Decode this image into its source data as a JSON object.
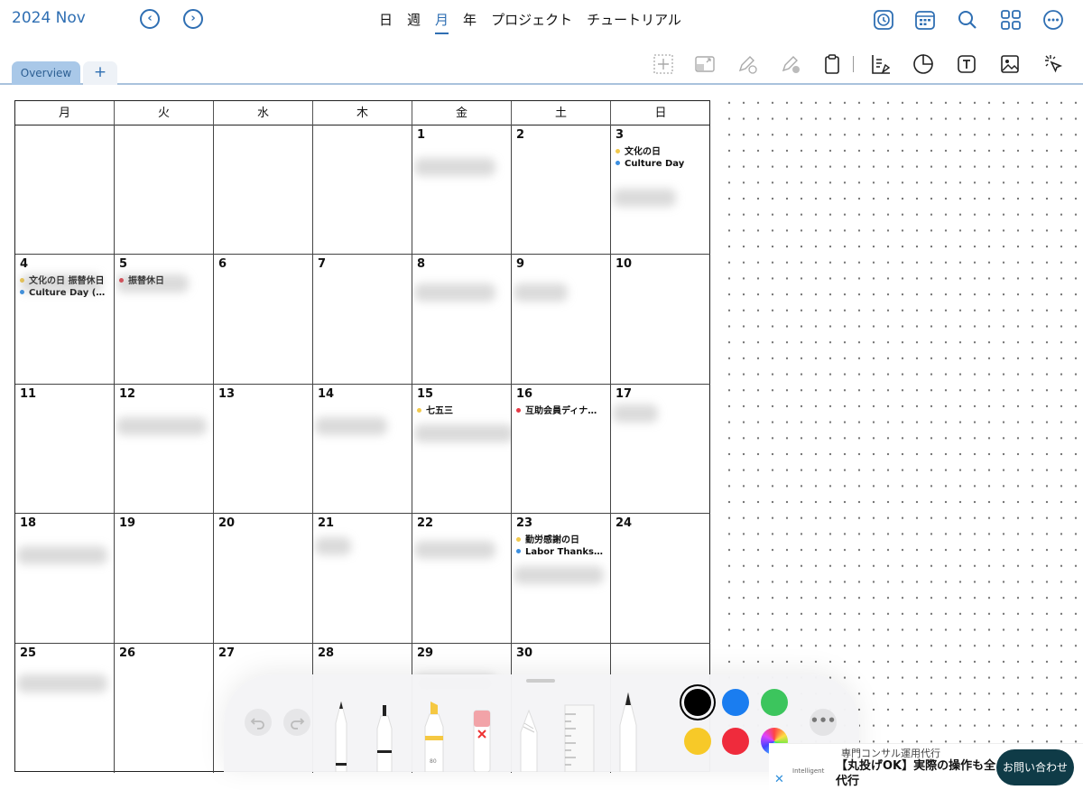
{
  "header": {
    "month_title": "2024 Nov",
    "prev_glyph": "‹",
    "next_glyph": "›",
    "views": [
      "日",
      "週",
      "月",
      "年",
      "プロジェクト",
      "チュートリアル"
    ],
    "active_view": "月",
    "icons": [
      "clock-icon",
      "calendar-icon",
      "search-icon",
      "grid-icon",
      "more-icon"
    ]
  },
  "tabs": {
    "overview": "Overview",
    "add": "+"
  },
  "tools": [
    "lasso-select-icon",
    "resize-icon",
    "pencil-circle-icon",
    "pencil-circle-alt-icon",
    "clipboard-icon",
    "shapes-icon",
    "sticker-icon",
    "text-box-icon",
    "image-icon",
    "pointer-icon"
  ],
  "calendar": {
    "weekdays": [
      "月",
      "火",
      "水",
      "木",
      "金",
      "土",
      "日"
    ],
    "weeks": [
      [
        {
          "day": "",
          "events": []
        },
        {
          "day": "",
          "events": []
        },
        {
          "day": "",
          "events": []
        },
        {
          "day": "",
          "events": []
        },
        {
          "day": "1",
          "events": []
        },
        {
          "day": "2",
          "events": []
        },
        {
          "day": "3",
          "events": [
            {
              "text": "文化の日",
              "color": "#f2c94c"
            },
            {
              "text": "Culture Day",
              "color": "#3b8fe0"
            }
          ]
        }
      ],
      [
        {
          "day": "4",
          "events": [
            {
              "text": "文化の日 振替休日",
              "color": "#f2c94c"
            },
            {
              "text": "Culture Day (o…",
              "color": "#3b8fe0"
            }
          ]
        },
        {
          "day": "5",
          "events": [
            {
              "text": "振替休日",
              "color": "#e53945"
            }
          ]
        },
        {
          "day": "6",
          "events": []
        },
        {
          "day": "7",
          "events": []
        },
        {
          "day": "8",
          "events": []
        },
        {
          "day": "9",
          "events": []
        },
        {
          "day": "10",
          "events": []
        }
      ],
      [
        {
          "day": "11",
          "events": []
        },
        {
          "day": "12",
          "events": []
        },
        {
          "day": "13",
          "events": []
        },
        {
          "day": "14",
          "events": []
        },
        {
          "day": "15",
          "events": [
            {
              "text": "七五三",
              "color": "#f2c94c"
            }
          ]
        },
        {
          "day": "16",
          "events": [
            {
              "text": "互助会員ディナ…",
              "color": "#e53945"
            }
          ]
        },
        {
          "day": "17",
          "events": []
        }
      ],
      [
        {
          "day": "18",
          "events": []
        },
        {
          "day": "19",
          "events": []
        },
        {
          "day": "20",
          "events": []
        },
        {
          "day": "21",
          "events": []
        },
        {
          "day": "22",
          "events": []
        },
        {
          "day": "23",
          "events": [
            {
              "text": "勤労感謝の日",
              "color": "#f2c94c"
            },
            {
              "text": "Labor Thanks…",
              "color": "#3b8fe0"
            }
          ]
        },
        {
          "day": "24",
          "events": []
        }
      ],
      [
        {
          "day": "25",
          "events": []
        },
        {
          "day": "26",
          "events": []
        },
        {
          "day": "27",
          "events": []
        },
        {
          "day": "28",
          "events": []
        },
        {
          "day": "29",
          "events": []
        },
        {
          "day": "30",
          "events": []
        },
        {
          "day": "",
          "events": []
        }
      ]
    ]
  },
  "pencil_toolbar": {
    "undo_icon": "undo-icon",
    "redo_icon": "redo-icon",
    "tools": [
      "pen-icon",
      "fineliner-icon",
      "highlighter-icon",
      "eraser-icon",
      "pencil-icon",
      "ruler-icon",
      "brush-icon"
    ],
    "highlighter_label": "80",
    "colors": [
      "#000000",
      "#1a7df0",
      "#3cc55d",
      "#f7c928",
      "#ef2b3c"
    ],
    "selected_color": "#000000",
    "more_glyph": "•••"
  },
  "ad": {
    "top_text": "専門コンサル運用代行",
    "headline": "【丸投げOK】実際の操作も全代行",
    "logo_text": "Intelligent",
    "cta": "お問い合わせ",
    "close": "✕"
  }
}
